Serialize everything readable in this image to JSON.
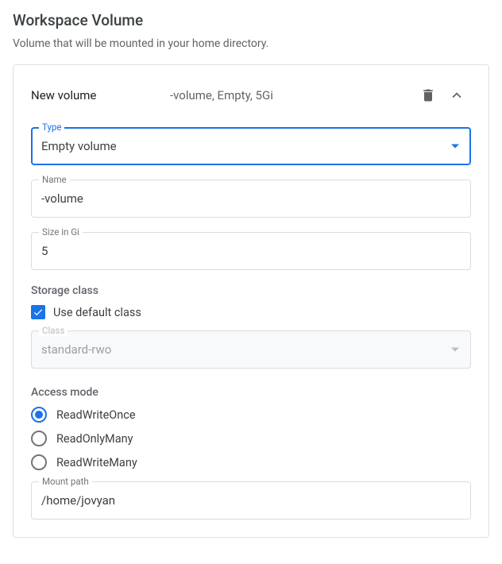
{
  "header": {
    "title": "Workspace Volume",
    "description": "Volume that will be mounted in your home directory."
  },
  "card": {
    "title": "New volume",
    "summary": "-volume, Empty, 5Gi"
  },
  "type_field": {
    "label": "Type",
    "value": "Empty volume"
  },
  "name_field": {
    "label": "Name",
    "value": "-volume"
  },
  "size_field": {
    "label": "Size in Gi",
    "value": "5"
  },
  "storage_class": {
    "title": "Storage class",
    "checkbox_label": "Use default class",
    "class_label": "Class",
    "class_value": "standard-rwo"
  },
  "access_mode": {
    "title": "Access mode",
    "options": {
      "rwo": "ReadWriteOnce",
      "rom": "ReadOnlyMany",
      "rwm": "ReadWriteMany"
    }
  },
  "mount_path": {
    "label": "Mount path",
    "value": "/home/jovyan"
  }
}
